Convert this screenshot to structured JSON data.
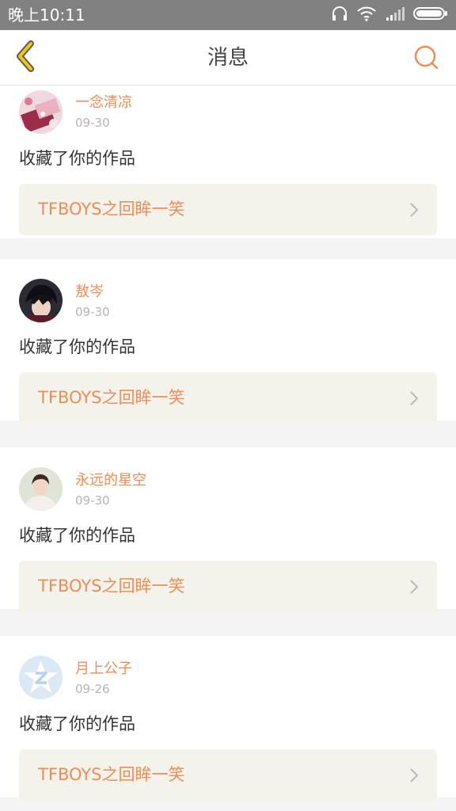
{
  "status_bar": {
    "time": "晚上10:11",
    "icons": [
      "headphones-icon",
      "wifi-icon",
      "signal-icon",
      "battery-icon"
    ]
  },
  "header": {
    "title": "消息",
    "back_icon": "chevron-left-icon",
    "search_icon": "search-icon"
  },
  "colors": {
    "accent": "#ee8d55",
    "back_arrow": "#f1c40f",
    "status_bar_bg": "#818181",
    "card_link_bg": "#f3f3ec",
    "separator_bg": "#f4f4f4"
  },
  "notifications": [
    {
      "user": "一念清凉",
      "date": "09-30",
      "action": "收藏了你的作品",
      "work_title": "TFBOYS之回眸一笑",
      "avatar": "avatar-floral"
    },
    {
      "user": "敖岑",
      "date": "09-30",
      "action": "收藏了你的作品",
      "work_title": "TFBOYS之回眸一笑",
      "avatar": "avatar-anime"
    },
    {
      "user": "永远的星空",
      "date": "09-30",
      "action": "收藏了你的作品",
      "work_title": "TFBOYS之回眸一笑",
      "avatar": "avatar-portrait"
    },
    {
      "user": "月上公子",
      "date": "09-26",
      "action": "收藏了你的作品",
      "work_title": "TFBOYS之回眸一笑",
      "avatar": "avatar-qzone-star"
    }
  ]
}
